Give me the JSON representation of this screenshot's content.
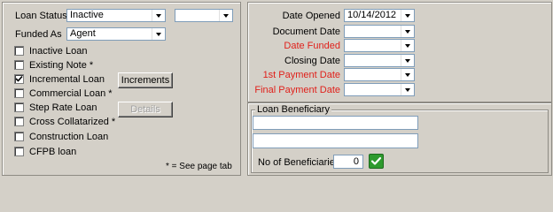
{
  "left": {
    "loan_status_label": "Loan Status",
    "loan_status_value": "Inactive",
    "loan_status_extra_value": "",
    "funded_as_label": "Funded As",
    "funded_as_value": "Agent",
    "checkboxes": [
      {
        "label": "Inactive Loan",
        "checked": false
      },
      {
        "label": "Existing Note *",
        "checked": false
      },
      {
        "label": "Incremental Loan",
        "checked": true
      },
      {
        "label": "Commercial Loan *",
        "checked": false
      },
      {
        "label": "Step Rate Loan",
        "checked": false
      },
      {
        "label": "Cross Collatarized *",
        "checked": false
      },
      {
        "label": "Construction Loan",
        "checked": false
      },
      {
        "label": "CFPB loan",
        "checked": false
      }
    ],
    "increments_button": "Increments",
    "details_button": "Details",
    "page_tab_note": "* = See page tab"
  },
  "right": {
    "dates": [
      {
        "label": "Date Opened",
        "value": "10/14/2012",
        "required": false
      },
      {
        "label": "Document Date",
        "value": "",
        "required": false
      },
      {
        "label": "Date Funded",
        "value": "",
        "required": true
      },
      {
        "label": "Closing Date",
        "value": "",
        "required": false
      },
      {
        "label": "1st Payment Date",
        "value": "",
        "required": true
      },
      {
        "label": "Final Payment Date",
        "value": "",
        "required": true
      }
    ],
    "beneficiary_title": "Loan Beneficiary",
    "beneficiary_line1": "",
    "beneficiary_line2": "",
    "num_beneficiaries_label": "No of Beneficiaries",
    "num_beneficiaries_value": "0"
  },
  "colors": {
    "required_label": "#e0211b",
    "confirm_button": "#2e9a2e"
  }
}
